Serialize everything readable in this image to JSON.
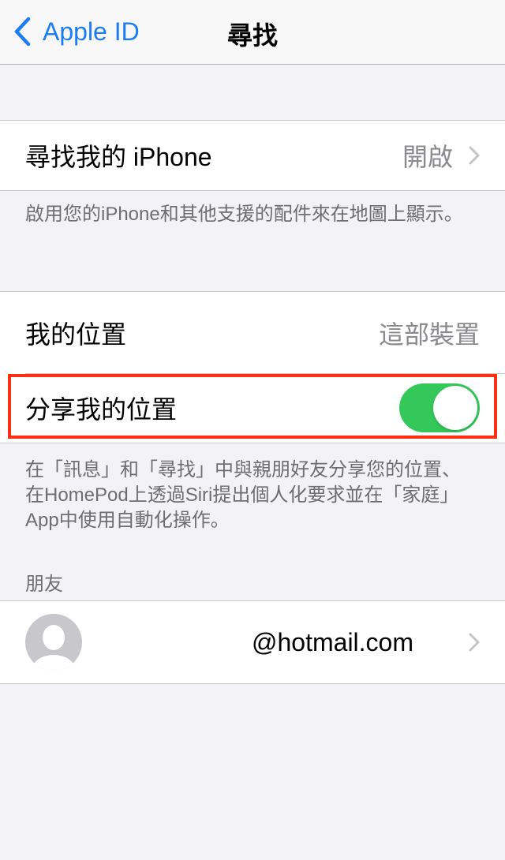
{
  "nav": {
    "back_label": "Apple ID",
    "title": "尋找"
  },
  "find_iphone": {
    "label": "尋找我的 iPhone",
    "value": "開啟",
    "footer": "啟用您的iPhone和其他支援的配件來在地圖上顯示。"
  },
  "location": {
    "my_location_label": "我的位置",
    "my_location_value": "這部裝置",
    "share_label": "分享我的位置",
    "share_enabled": true,
    "footer": "在「訊息」和「尋找」中與親朋好友分享您的位置、在HomePod上透過Siri提出個人化要求並在「家庭」App中使用自動化操作。"
  },
  "friends": {
    "header": "朋友",
    "items": [
      {
        "name": "@hotmail.com"
      }
    ]
  },
  "colors": {
    "accent": "#1c7cf4",
    "toggle_on": "#34c759",
    "highlight": "#ff2f14"
  }
}
